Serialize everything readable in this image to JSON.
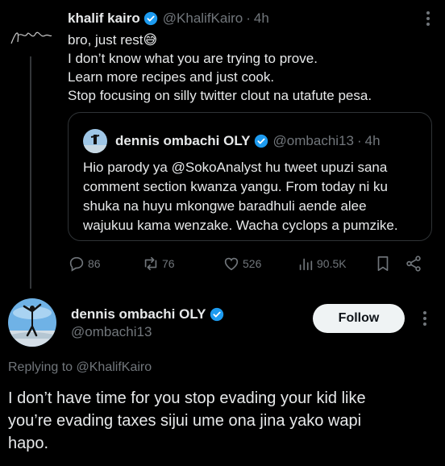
{
  "parent_tweet": {
    "name": "khalif kairo",
    "handle": "@KhalifKairo",
    "time": "4h",
    "lines": [
      "bro, just rest😅",
      "I don’t know what you are trying to prove.",
      "Learn more recipes and just cook.",
      "Stop focusing on silly twitter clout na utafute pesa."
    ],
    "quote": {
      "name": "dennis ombachi OLY",
      "handle": "@ombachi13",
      "time": "4h",
      "lines": [
        "Hio parody ya @SokoAnalyst hu tweet upuzi sana",
        "comment section kwanza yangu. From today ni ku",
        "shuka na huyu mkongwe baradhuli aende alee",
        "wajukuu kama wenzake. Wacha cyclops a pumzike."
      ]
    },
    "actions": {
      "replies": "86",
      "reposts": "76",
      "likes": "526",
      "views": "90.5K"
    }
  },
  "reply_tweet": {
    "name": "dennis ombachi OLY",
    "handle": "@ombachi13",
    "follow_label": "Follow",
    "replying_prefix": "Replying to",
    "replying_handle": "@KhalifKairo",
    "lines": [
      "I don’t have time for you stop evading your kid like",
      "you’re evading taxes sijui ume ona jina yako wapi",
      "hapo."
    ]
  },
  "colors": {
    "background": "#000000",
    "text": "#e7e9ea",
    "muted": "#71767b",
    "verified": "#1d9bf0",
    "border": "#2f3336"
  },
  "icons": [
    "reply-icon",
    "repost-icon",
    "like-icon",
    "views-icon",
    "bookmark-icon",
    "share-icon",
    "verified-icon",
    "more-icon"
  ]
}
